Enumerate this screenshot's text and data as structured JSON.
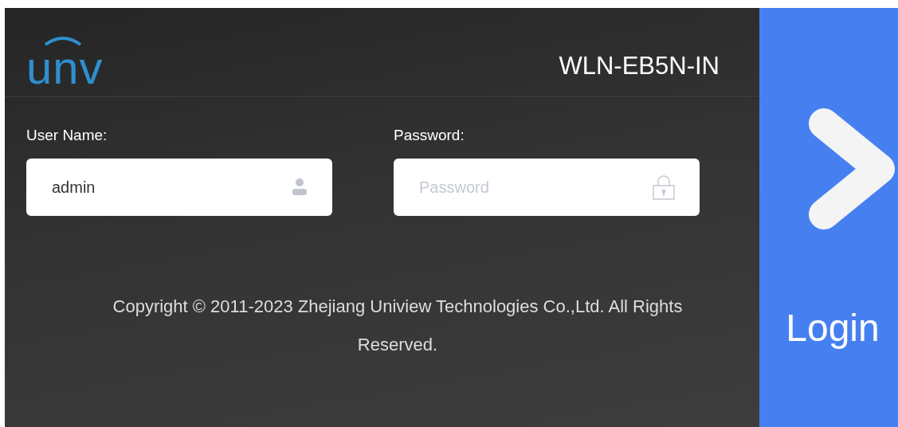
{
  "logo": {
    "text": "unv"
  },
  "model": "WLN-EB5N-IN",
  "fields": [
    {
      "kind": "user",
      "label": "User Name:",
      "value": "admin"
    },
    {
      "kind": "password",
      "label": "Password:",
      "placeholder": "Password"
    }
  ],
  "copyright": "Copyright © 2011-2023 Zhejiang Uniview Technologies Co.,Ltd. All Rights Reserved.",
  "login_button": {
    "label": "Login"
  }
}
